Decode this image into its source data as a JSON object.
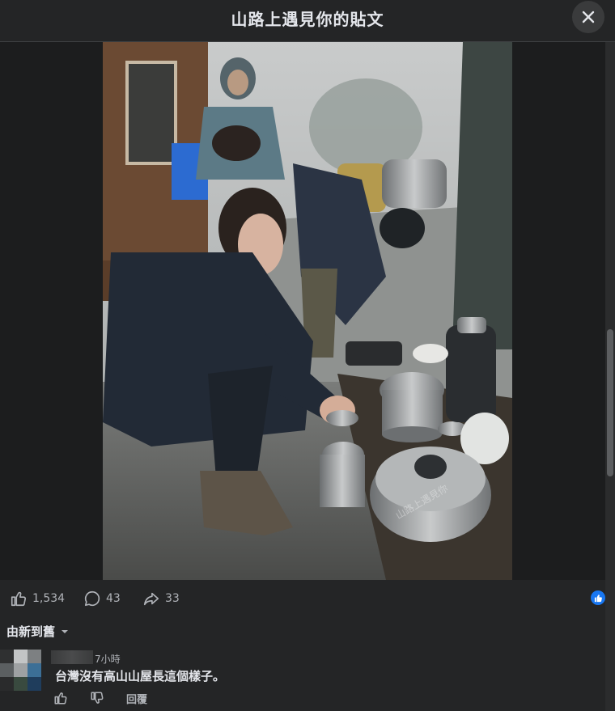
{
  "header": {
    "title": "山路上遇見你的貼文",
    "close_icon": "close-icon"
  },
  "post_image": {
    "icon": "photo-image",
    "watermark": "山路上遇見你"
  },
  "actions": {
    "like_count": "1,534",
    "comment_count": "43",
    "share_count": "33"
  },
  "sort": {
    "label": "由新到舊"
  },
  "comment": {
    "time": "7小時",
    "text": "台灣沒有高山山屋長這個樣子。",
    "reply_label": "回覆"
  },
  "colors": {
    "accent": "#1877f2",
    "background": "#242526",
    "text": "#e4e6eb",
    "muted": "#b0b3b8"
  }
}
